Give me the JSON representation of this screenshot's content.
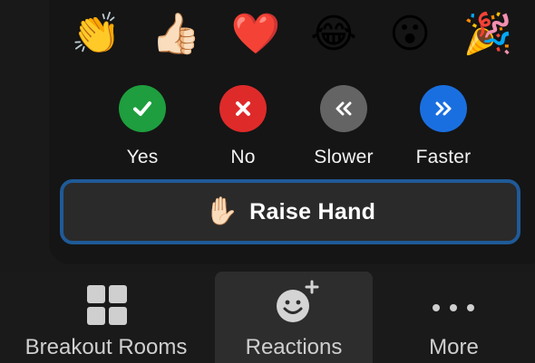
{
  "reactions": {
    "emojis": [
      {
        "name": "clapping-hands",
        "glyph": "👏"
      },
      {
        "name": "thumbs-up",
        "glyph": "👍🏻"
      },
      {
        "name": "red-heart",
        "glyph": "❤️"
      },
      {
        "name": "tears-of-joy",
        "glyph": "😂"
      },
      {
        "name": "open-mouth",
        "glyph": "😮"
      },
      {
        "name": "party-popper",
        "glyph": "🎉"
      }
    ],
    "feedback": [
      {
        "label": "Yes",
        "color": "#1e9e3e",
        "icon": "check-icon"
      },
      {
        "label": "No",
        "color": "#df2a2a",
        "icon": "x-icon"
      },
      {
        "label": "Slower",
        "color": "#646464",
        "icon": "double-chevron-left-icon"
      },
      {
        "label": "Faster",
        "color": "#1a6fe0",
        "icon": "double-chevron-right-icon"
      }
    ],
    "raise_hand": {
      "label": "Raise Hand",
      "glyph": "✋🏻",
      "border_color": "#1f5a97"
    }
  },
  "toolbar": {
    "items": [
      {
        "label": "Breakout Rooms",
        "icon": "grid-icon"
      },
      {
        "label": "Reactions",
        "icon": "smiley-plus-icon",
        "active": true
      },
      {
        "label": "More",
        "icon": "more-dots-icon"
      }
    ]
  }
}
